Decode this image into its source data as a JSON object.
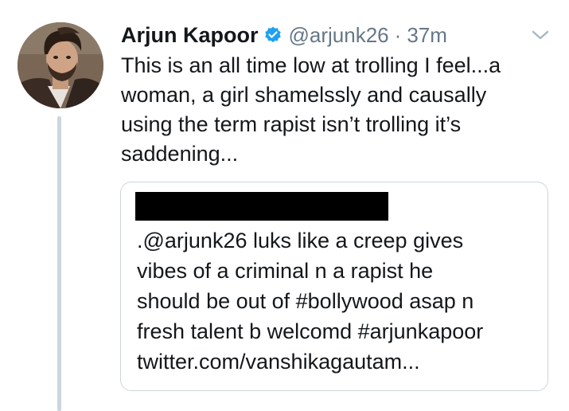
{
  "tweet": {
    "author_name": "Arjun Kapoor",
    "handle": "@arjunk26",
    "separator": "·",
    "time": "37m",
    "text": "This is an all time low at trolling I feel...a\nwoman, a girl shamelssly and causally\nusing the term rapist isn’t trolling it’s\nsaddening...",
    "verified": true
  },
  "quoted_tweet": {
    "author_redacted": true,
    "text": ".@arjunk26 luks like a creep gives\nvibes of a criminal n a rapist he\nshould be out of #bollywood asap n\nfresh talent b welcomd #arjunkapoor\ntwitter.com/vanshikagautam..."
  },
  "icons": {
    "verified": "verified-badge-icon",
    "caret": "chevron-down-icon"
  },
  "colors": {
    "verified_blue": "#1da1f2",
    "secondary_text": "#657786",
    "thread_line": "#ccd6dd",
    "border": "#ccd6dd"
  }
}
